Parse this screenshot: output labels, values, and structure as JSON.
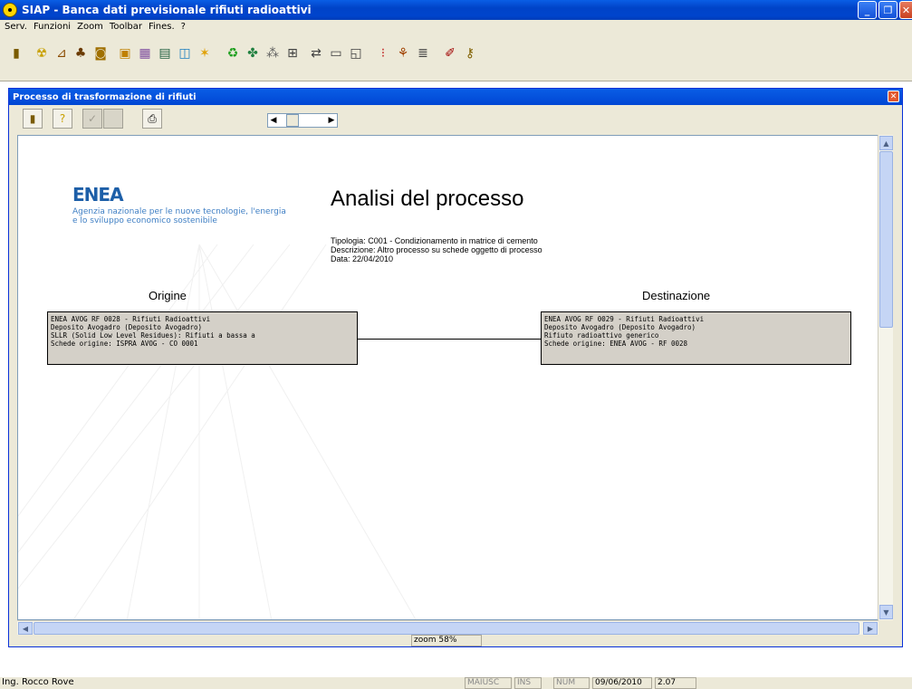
{
  "window": {
    "title": "SIAP - Banca dati previsionale rifiuti radioattivi"
  },
  "menu": [
    "Serv.",
    "Funzioni",
    "Zoom",
    "Toolbar",
    "Fines.",
    "?"
  ],
  "child": {
    "title": "Processo di trasformazione di rifiuti",
    "zoom_label": "zoom 58%"
  },
  "document": {
    "logo": "ENEA",
    "logo_tagline_1": "Agenzia nazionale per le nuove tecnologie, l'energia",
    "logo_tagline_2": "e lo sviluppo economico sostenibile",
    "title": "Analisi del processo",
    "tipologia": "Tipologia: C001  - Condizionamento in matrice di cemento",
    "descrizione": "Descrizione: Altro processo su schede oggetto di processo",
    "data": "Data: 22/04/2010",
    "origin_label": "Origine",
    "dest_label": "Destinazione",
    "origin_lines": [
      "ENEA AVOG RF 0028 - Rifiuti Radioattivi",
      "Deposito Avogadro (Deposito Avogadro)",
      "SLLR (Solid Low Level Residues): Rifiuti a bassa a",
      "Schede origine: ISPRA AVOG - CO 0001"
    ],
    "dest_lines": [
      "ENEA AVOG RF  0029 - Rifiuti Radioattivi",
      "Deposito Avogadro (Deposito Avogadro)",
      "Rifiuto radioattivo generico",
      "Schede origine: ENEA AVOG - RF 0028"
    ]
  },
  "statusbar": {
    "user": "Ing. Rocco Rove",
    "maiusc": "MAIUSC",
    "ins": "INS",
    "num": "NUM",
    "date": "09/06/2010",
    "time": "2.07"
  },
  "colors": {
    "titlebar": "#0046d4",
    "logo": "#1d5fa8",
    "box_fill": "#d4d0c8"
  }
}
